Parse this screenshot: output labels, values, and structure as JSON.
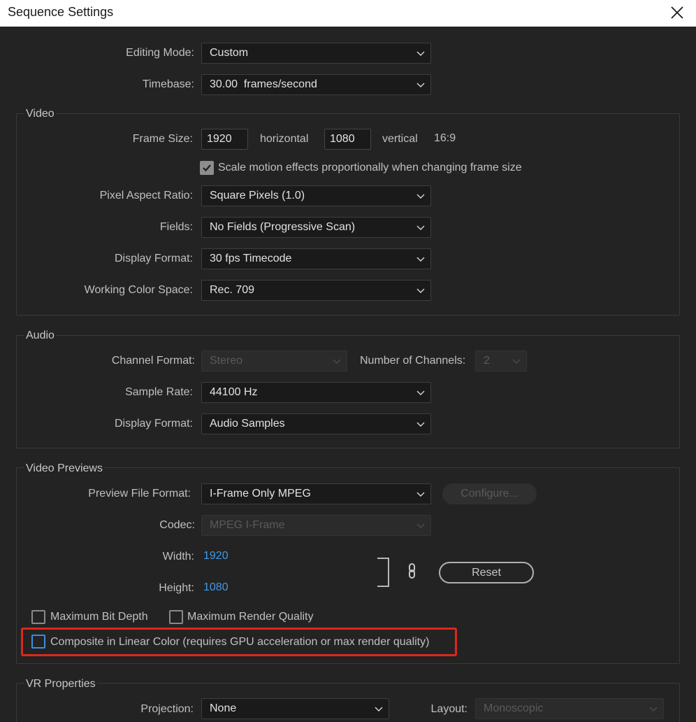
{
  "window": {
    "title": "Sequence Settings"
  },
  "general": {
    "editing_mode": {
      "label": "Editing Mode:",
      "value": "Custom"
    },
    "timebase": {
      "label": "Timebase:",
      "value": "30.00  frames/second"
    }
  },
  "video": {
    "title": "Video",
    "frame_size": {
      "label": "Frame Size:",
      "width": "1920",
      "horizontal": "horizontal",
      "height": "1080",
      "vertical": "vertical",
      "ratio": "16:9"
    },
    "scale_motion": {
      "label": "Scale motion effects proportionally when changing frame size",
      "checked": true
    },
    "pixel_aspect": {
      "label": "Pixel Aspect Ratio:",
      "value": "Square Pixels (1.0)"
    },
    "fields": {
      "label": "Fields:",
      "value": "No Fields (Progressive Scan)"
    },
    "display_format": {
      "label": "Display Format:",
      "value": "30 fps Timecode"
    },
    "color_space": {
      "label": "Working Color Space:",
      "value": "Rec. 709"
    }
  },
  "audio": {
    "title": "Audio",
    "channel_format": {
      "label": "Channel Format:",
      "value": "Stereo"
    },
    "num_channels": {
      "label": "Number of Channels:",
      "value": "2"
    },
    "sample_rate": {
      "label": "Sample Rate:",
      "value": "44100 Hz"
    },
    "display_format": {
      "label": "Display Format:",
      "value": "Audio Samples"
    }
  },
  "previews": {
    "title": "Video Previews",
    "file_format": {
      "label": "Preview File Format:",
      "value": "I-Frame Only MPEG"
    },
    "configure": "Configure...",
    "codec": {
      "label": "Codec:",
      "value": "MPEG I-Frame"
    },
    "width": {
      "label": "Width:",
      "value": "1920"
    },
    "height": {
      "label": "Height:",
      "value": "1080"
    },
    "reset": "Reset",
    "max_bit_depth": {
      "label": "Maximum Bit Depth",
      "checked": false
    },
    "max_render_quality": {
      "label": "Maximum Render Quality",
      "checked": false
    },
    "linear_color": {
      "label": "Composite in Linear Color (requires GPU acceleration or max render quality)",
      "checked": false
    }
  },
  "vr": {
    "title": "VR Properties",
    "projection": {
      "label": "Projection:",
      "value": "None"
    },
    "layout": {
      "label": "Layout:",
      "value": "Monoscopic"
    }
  },
  "colors": {
    "highlight": "#e0261c",
    "accent": "#3f9ae8"
  },
  "icons": {
    "close": "close-icon",
    "chevron": "chevron-down-icon",
    "link": "link-icon"
  }
}
